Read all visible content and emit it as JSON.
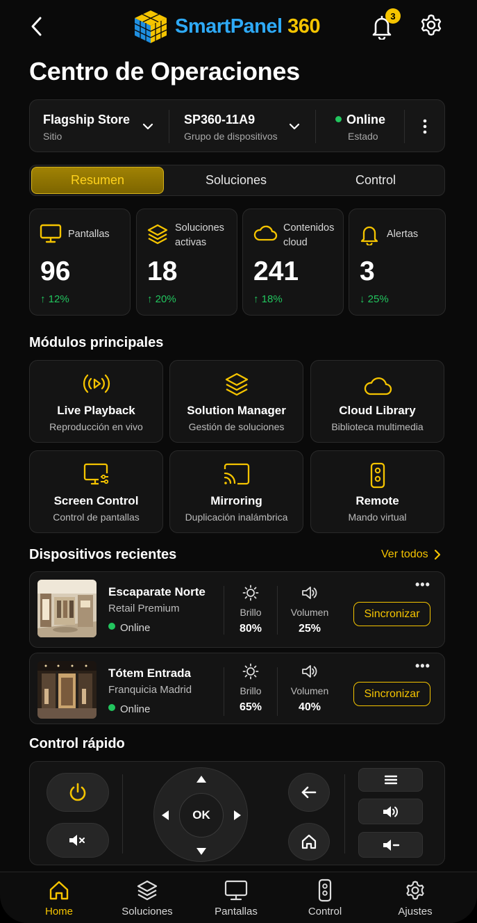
{
  "header": {
    "logo_part1": "SmartPanel",
    "logo_part2": "360",
    "notification_count": "3"
  },
  "page_title": "Centro de Operaciones",
  "selector": {
    "site_value": "Flagship Store",
    "site_label": "Sitio",
    "group_value": "SP360-11A9",
    "group_label": "Grupo de dispositivos",
    "status_value": "Online",
    "status_label": "Estado"
  },
  "tabs": [
    {
      "label": "Resumen",
      "active": true
    },
    {
      "label": "Soluciones",
      "active": false
    },
    {
      "label": "Control",
      "active": false
    }
  ],
  "stats": [
    {
      "label": "Pantallas",
      "value": "96",
      "trend": "↑ 12%",
      "trend_direction": "up",
      "icon": "monitor-icon"
    },
    {
      "label_line1": "Soluciones",
      "label_line2": "activas",
      "value": "18",
      "trend": "↑ 20%",
      "trend_direction": "up",
      "icon": "layers-icon"
    },
    {
      "label_line1": "Contenidos",
      "label_line2": "cloud",
      "value": "241",
      "trend": "↑ 18%",
      "trend_direction": "up",
      "icon": "cloud-icon"
    },
    {
      "label": "Alertas",
      "value": "3",
      "trend": "↓ 25%",
      "trend_direction": "down",
      "icon": "bell-icon"
    }
  ],
  "modules_title": "Módulos principales",
  "modules": [
    {
      "title": "Live Playback",
      "subtitle": "Reproducción en vivo",
      "icon": "broadcast-play-icon"
    },
    {
      "title": "Solution Manager",
      "subtitle": "Gestión de soluciones",
      "icon": "layers-icon"
    },
    {
      "title": "Cloud Library",
      "subtitle": "Biblioteca multimedia",
      "icon": "cloud-icon"
    },
    {
      "title": "Screen Control",
      "subtitle": "Control de pantallas",
      "icon": "screen-settings-icon"
    },
    {
      "title": "Mirroring",
      "subtitle": "Duplicación inalámbrica",
      "icon": "cast-icon"
    },
    {
      "title": "Remote",
      "subtitle": "Mando virtual",
      "icon": "remote-icon"
    }
  ],
  "devices_title": "Dispositivos recientes",
  "see_all": "Ver todos",
  "devices": [
    {
      "name": "Escaparate Norte",
      "group": "Retail Premium",
      "status": "Online",
      "brightness_label": "Brillo",
      "brightness": "80%",
      "volume_label": "Volumen",
      "volume": "25%",
      "sync_label": "Sincronizar",
      "more": "•••"
    },
    {
      "name": "Tótem Entrada",
      "group": "Franquicia Madrid",
      "status": "Online",
      "brightness_label": "Brillo",
      "brightness": "65%",
      "volume_label": "Volumen",
      "volume": "40%",
      "sync_label": "Sincronizar",
      "more": "•••"
    }
  ],
  "quick_title": "Control rápido",
  "quick": {
    "ok_label": "OK"
  },
  "nav": [
    {
      "label": "Home",
      "active": true,
      "icon": "home-icon"
    },
    {
      "label": "Soluciones",
      "active": false,
      "icon": "layers-icon"
    },
    {
      "label": "Pantallas",
      "active": false,
      "icon": "monitor-icon"
    },
    {
      "label": "Control",
      "active": false,
      "icon": "remote-icon"
    },
    {
      "label": "Ajustes",
      "active": false,
      "icon": "gear-icon"
    }
  ],
  "colors": {
    "accent": "#f5c400",
    "logo_blue": "#2ea9f5",
    "positive": "#22c55e",
    "background": "#0a0a0a",
    "card": "#141414"
  }
}
